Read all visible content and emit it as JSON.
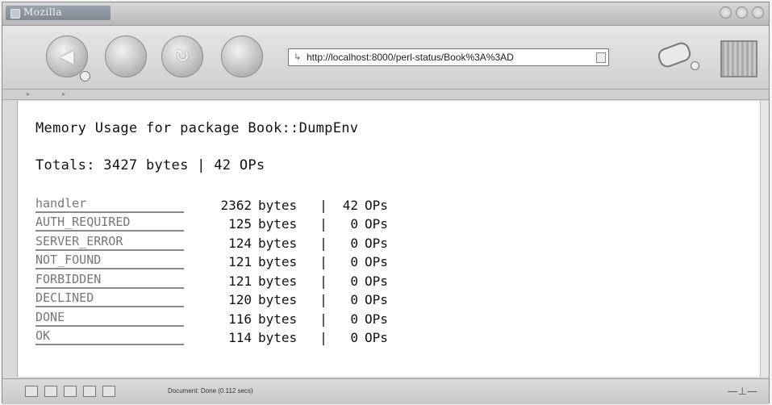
{
  "window": {
    "title": "Mozilla"
  },
  "nav": {
    "back_icon": "back-arrow-icon",
    "forward_icon": "forward-arrow-icon",
    "reload_icon": "reload-icon",
    "stop_icon": "stop-icon"
  },
  "urlbar": {
    "value": "http://localhost:8000/perl-status/Book%3A%3AD"
  },
  "page": {
    "heading": "Memory Usage for package Book::DumpEnv",
    "totals": "Totals: 3427 bytes | 42 OPs",
    "bytes_unit": "bytes",
    "ops_unit": "OPs",
    "separator": "|",
    "rows": [
      {
        "name": "handler",
        "bytes": "2362",
        "ops": "42"
      },
      {
        "name": "AUTH_REQUIRED",
        "bytes": "125",
        "ops": "0"
      },
      {
        "name": "SERVER_ERROR",
        "bytes": "124",
        "ops": "0"
      },
      {
        "name": "NOT_FOUND",
        "bytes": "121",
        "ops": "0"
      },
      {
        "name": "FORBIDDEN",
        "bytes": "121",
        "ops": "0"
      },
      {
        "name": "DECLINED",
        "bytes": "120",
        "ops": "0"
      },
      {
        "name": "DONE",
        "bytes": "116",
        "ops": "0"
      },
      {
        "name": "OK",
        "bytes": "114",
        "ops": "0"
      }
    ]
  },
  "status": {
    "text": "Document: Done (0.112 secs)"
  }
}
